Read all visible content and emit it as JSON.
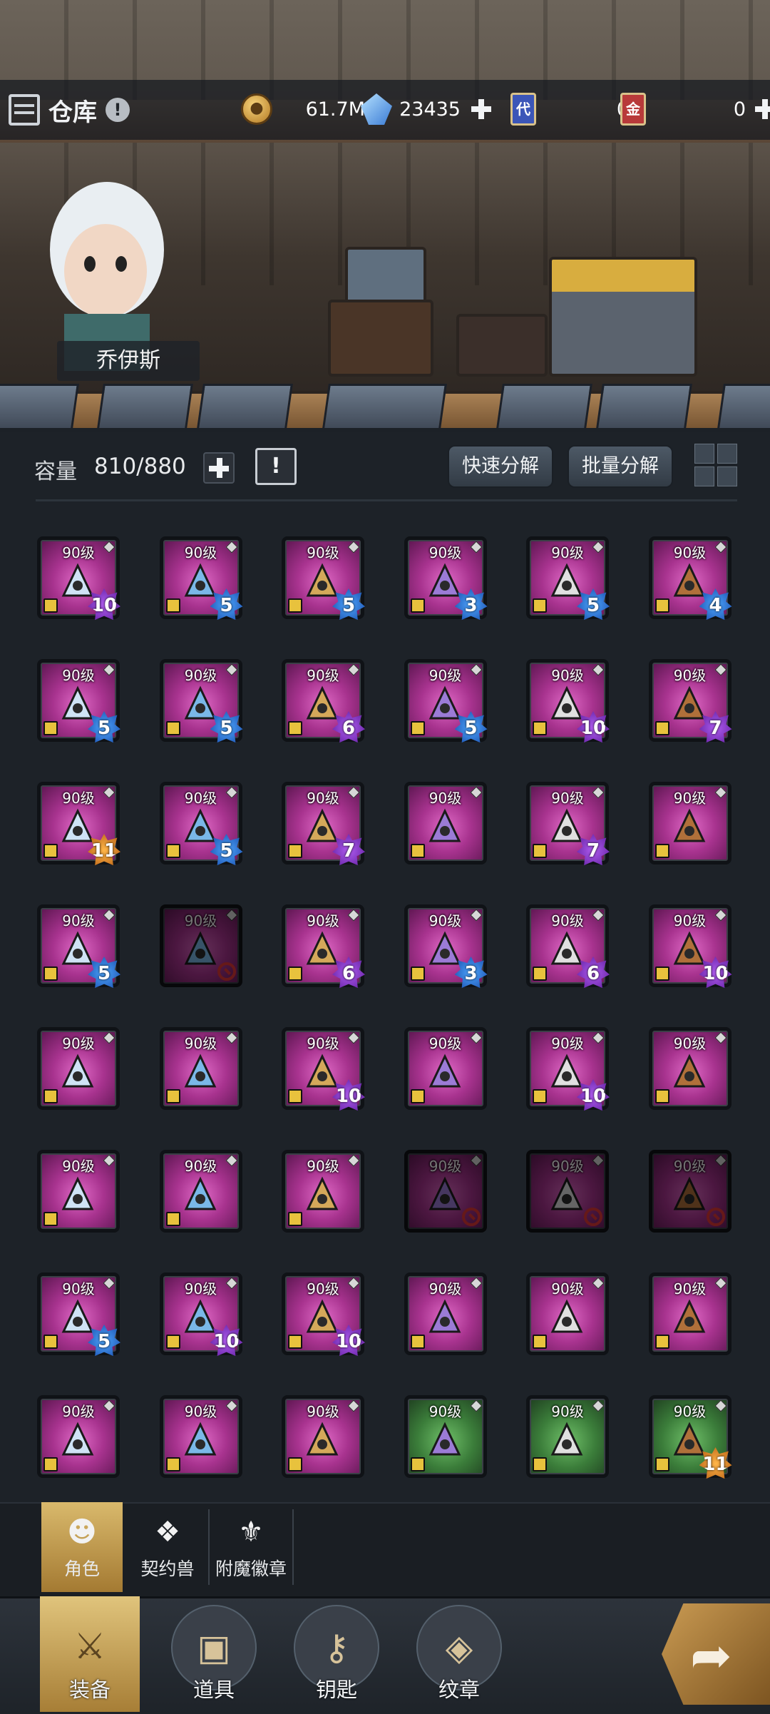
{
  "header": {
    "title": "仓库",
    "info_icon": "!",
    "resources": {
      "gold": {
        "value": "61.7M",
        "icon": "gold-coin-icon"
      },
      "crystal": {
        "value": "23435",
        "icon": "crystal-gem-icon"
      },
      "ticket_blue": {
        "label": "代",
        "value": "0"
      },
      "ticket_red": {
        "label": "金",
        "value": "0"
      }
    }
  },
  "hero": {
    "name": "乔伊斯"
  },
  "capacity": {
    "label": "容量",
    "value": "810/880"
  },
  "actions": {
    "quick_decompose": "快速分解",
    "batch_decompose": "批量分解"
  },
  "items": [
    {
      "level": "90级",
      "star": "10",
      "color": "purple",
      "locked": true
    },
    {
      "level": "90级",
      "star": "5",
      "color": "blue",
      "locked": true
    },
    {
      "level": "90级",
      "star": "5",
      "color": "blue",
      "locked": true
    },
    {
      "level": "90级",
      "star": "3",
      "color": "blue",
      "locked": true
    },
    {
      "level": "90级",
      "star": "5",
      "color": "blue",
      "locked": true
    },
    {
      "level": "90级",
      "star": "4",
      "color": "blue",
      "locked": true
    },
    {
      "level": "90级",
      "star": "5",
      "color": "blue",
      "locked": true
    },
    {
      "level": "90级",
      "star": "5",
      "color": "blue",
      "locked": true
    },
    {
      "level": "90级",
      "star": "6",
      "color": "purple",
      "locked": true
    },
    {
      "level": "90级",
      "star": "5",
      "color": "blue",
      "locked": true
    },
    {
      "level": "90级",
      "star": "10",
      "color": "purple",
      "locked": true
    },
    {
      "level": "90级",
      "star": "7",
      "color": "purple",
      "locked": true
    },
    {
      "level": "90级",
      "star": "11",
      "color": "orange",
      "locked": true
    },
    {
      "level": "90级",
      "star": "5",
      "color": "blue",
      "locked": true
    },
    {
      "level": "90级",
      "star": "7",
      "color": "purple",
      "locked": true
    },
    {
      "level": "90级",
      "star": "",
      "color": "",
      "locked": true
    },
    {
      "level": "90级",
      "star": "7",
      "color": "purple",
      "locked": true
    },
    {
      "level": "90级",
      "star": "",
      "color": "",
      "locked": true
    },
    {
      "level": "90级",
      "star": "5",
      "color": "blue",
      "locked": true
    },
    {
      "level": "90级",
      "star": "",
      "color": "",
      "locked": false,
      "disabled": true
    },
    {
      "level": "90级",
      "star": "6",
      "color": "purple",
      "locked": true
    },
    {
      "level": "90级",
      "star": "3",
      "color": "blue",
      "locked": true
    },
    {
      "level": "90级",
      "star": "6",
      "color": "purple",
      "locked": true
    },
    {
      "level": "90级",
      "star": "10",
      "color": "purple",
      "locked": true
    },
    {
      "level": "90级",
      "star": "",
      "color": "",
      "locked": true
    },
    {
      "level": "90级",
      "star": "",
      "color": "",
      "locked": true
    },
    {
      "level": "90级",
      "star": "10",
      "color": "purple",
      "locked": true
    },
    {
      "level": "90级",
      "star": "",
      "color": "",
      "locked": true
    },
    {
      "level": "90级",
      "star": "10",
      "color": "purple",
      "locked": true
    },
    {
      "level": "90级",
      "star": "",
      "color": "",
      "locked": true
    },
    {
      "level": "90级",
      "star": "",
      "color": "",
      "locked": true
    },
    {
      "level": "90级",
      "star": "",
      "color": "",
      "locked": true
    },
    {
      "level": "90级",
      "star": "",
      "color": "",
      "locked": true
    },
    {
      "level": "90级",
      "star": "",
      "color": "",
      "locked": false,
      "disabled": true
    },
    {
      "level": "90级",
      "star": "",
      "color": "",
      "locked": false,
      "disabled": true
    },
    {
      "level": "90级",
      "star": "",
      "color": "",
      "locked": false,
      "disabled": true
    },
    {
      "level": "90级",
      "star": "5",
      "color": "blue",
      "locked": true
    },
    {
      "level": "90级",
      "star": "10",
      "color": "purple",
      "locked": true
    },
    {
      "level": "90级",
      "star": "10",
      "color": "purple",
      "locked": true
    },
    {
      "level": "90级",
      "star": "",
      "color": "",
      "locked": true
    },
    {
      "level": "90级",
      "star": "",
      "color": "",
      "locked": true
    },
    {
      "level": "90级",
      "star": "",
      "color": "",
      "locked": true
    },
    {
      "level": "90级",
      "star": "",
      "color": "",
      "locked": true
    },
    {
      "level": "90级",
      "star": "",
      "color": "",
      "locked": true
    },
    {
      "level": "90级",
      "star": "",
      "color": "",
      "locked": true
    },
    {
      "level": "90级",
      "star": "",
      "color": "",
      "locked": true,
      "bg": "green"
    },
    {
      "level": "90级",
      "star": "",
      "color": "",
      "locked": true,
      "bg": "green"
    },
    {
      "level": "90级",
      "star": "11",
      "color": "orange",
      "locked": true,
      "bg": "green"
    }
  ],
  "subtabs": [
    {
      "label": "角色",
      "icon": "character-head-icon",
      "active": true
    },
    {
      "label": "契约兽",
      "icon": "paw-icon",
      "active": false
    },
    {
      "label": "附魔徽章",
      "icon": "enchant-badge-icon",
      "active": false
    }
  ],
  "bottom_nav": [
    {
      "label": "装备",
      "icon": "equipment-icon",
      "active": true
    },
    {
      "label": "道具",
      "icon": "item-chest-icon",
      "active": false
    },
    {
      "label": "钥匙",
      "icon": "key-icon",
      "active": false
    },
    {
      "label": "纹章",
      "icon": "emblem-icon",
      "active": false
    }
  ],
  "share_icon": "share-arrow-icon"
}
